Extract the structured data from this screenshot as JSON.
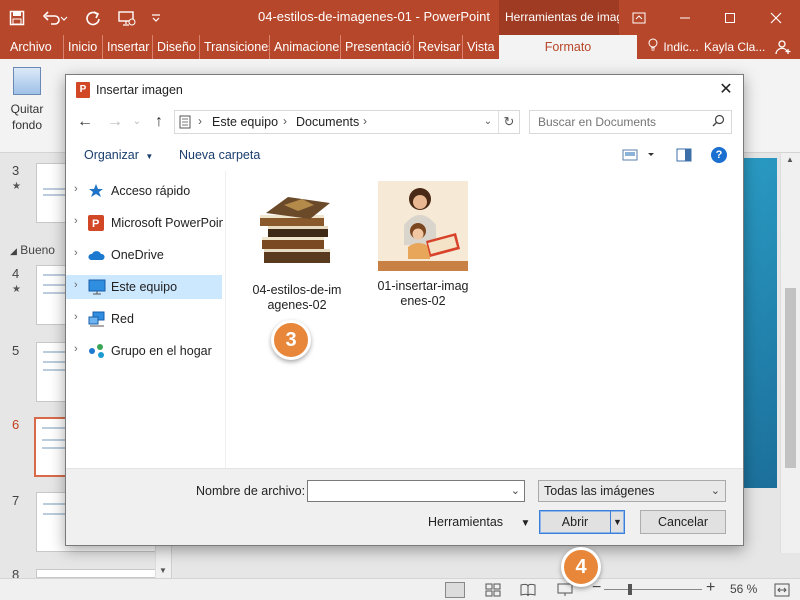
{
  "app": {
    "window_title": "04-estilos-de-imagenes-01 - PowerPoint",
    "context_group": "Herramientas de imag",
    "colors": {
      "accent": "#b7472a",
      "selection": "#cce8ff",
      "badge": "#e8873a"
    }
  },
  "ribbon_tabs": [
    "Archivo",
    "Inicio",
    "Insertar",
    "Diseño",
    "Transiciones",
    "Animacione",
    "Presentació",
    "Revisar",
    "Vista",
    "Formato"
  ],
  "tell_me": "Indic...",
  "user_name": "Kayla Cla...",
  "ribbon": {
    "remove_bg_label_1": "Quitar",
    "remove_bg_label_2": "fondo"
  },
  "slides_panel": {
    "section_name": "Bueno",
    "slides": [
      {
        "number": "3",
        "star": "★"
      },
      {
        "number": "4",
        "star": "★"
      },
      {
        "number": "5"
      },
      {
        "number": "6",
        "active": true
      },
      {
        "number": "7"
      },
      {
        "number": "8"
      }
    ]
  },
  "status_bar": {
    "zoom": "56 %",
    "minus": "−",
    "plus": "+"
  },
  "dialog": {
    "title": "Insertar imagen",
    "breadcrumb": [
      "Este equipo",
      "Documents"
    ],
    "search_placeholder": "Buscar en Documents",
    "organize": "Organizar",
    "new_folder": "Nueva carpeta",
    "nav_items": [
      {
        "label": "Acceso rápido",
        "icon": "star-icon"
      },
      {
        "label": "Microsoft PowerPoin",
        "icon": "powerpoint-icon"
      },
      {
        "label": "OneDrive",
        "icon": "onedrive-icon"
      },
      {
        "label": "Este equipo",
        "icon": "computer-icon",
        "selected": true
      },
      {
        "label": "Red",
        "icon": "network-icon"
      },
      {
        "label": "Grupo en el hogar",
        "icon": "homegroup-icon"
      }
    ],
    "files": [
      {
        "name_line1": "04-estilos-de-im",
        "name_line2": "agenes-02",
        "thumb": "books"
      },
      {
        "name_line1": "01-insertar-imag",
        "name_line2": "enes-02",
        "thumb": "mother-child-reading"
      }
    ],
    "filename_label": "Nombre de archivo:",
    "filename_value": "",
    "file_type": "Todas las imágenes",
    "tools": "Herramientas",
    "open": "Abrir",
    "cancel": "Cancelar"
  },
  "steps": [
    "3",
    "4"
  ]
}
